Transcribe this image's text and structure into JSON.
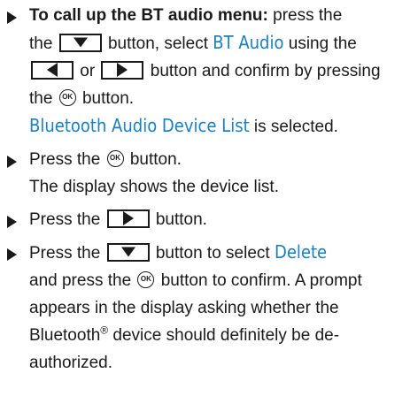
{
  "steps": [
    {
      "lead": "To call up the BT audio menu:",
      "t1": "press the",
      "t2": "button, select",
      "display1": "BT Audio",
      "t3": "using the",
      "t4": "or",
      "t5": "button and confirm by pressing the",
      "t6": "button.",
      "display2": "Bluetooth Audio Device List",
      "t7": "is selected."
    },
    {
      "t1": "Press the",
      "t2": "button.",
      "t3": "The display shows the device list."
    },
    {
      "t1": "Press the",
      "t2": "button."
    },
    {
      "t1": "Press the",
      "t2": "button to select",
      "display1": "Delete",
      "t3": "and press the",
      "t4": "button to confirm.",
      "t5": "A prompt appears in the display asking whether the Bluetooth",
      "reg": "®",
      "t6": "device should definitely be de-authorized."
    }
  ],
  "keys": {
    "down_icon": "down-arrow-button-icon",
    "left_icon": "left-arrow-button-icon",
    "right_icon": "right-arrow-button-icon",
    "ok_icon": "ok-button-icon",
    "ok_label": "OK"
  },
  "colors": {
    "display_text": "#1a7fc1",
    "body_text": "#1a1a1a"
  }
}
